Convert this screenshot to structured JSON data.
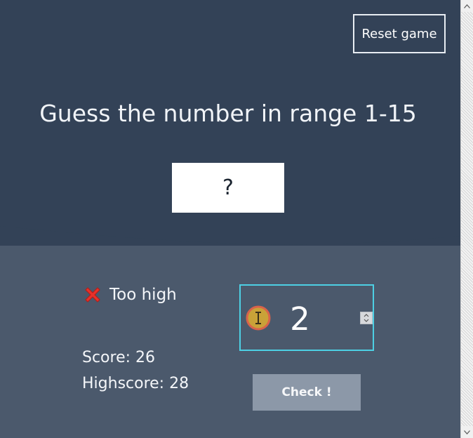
{
  "header": {
    "reset_label": "Reset game",
    "title": "Guess the number in range 1-15",
    "secret_display": "?"
  },
  "status": {
    "icon": "cross-mark-icon",
    "message": "Too high",
    "score_text": "Score: 26",
    "highscore_text": "Highscore: 28"
  },
  "guess": {
    "value": "2"
  },
  "actions": {
    "check_label": "Check !"
  },
  "colors": {
    "top_background": "#334257",
    "bottom_background": "#4b596c",
    "input_border": "#4dd0e4",
    "check_button": "#8c98a8",
    "cross_icon": "#e8312a"
  }
}
